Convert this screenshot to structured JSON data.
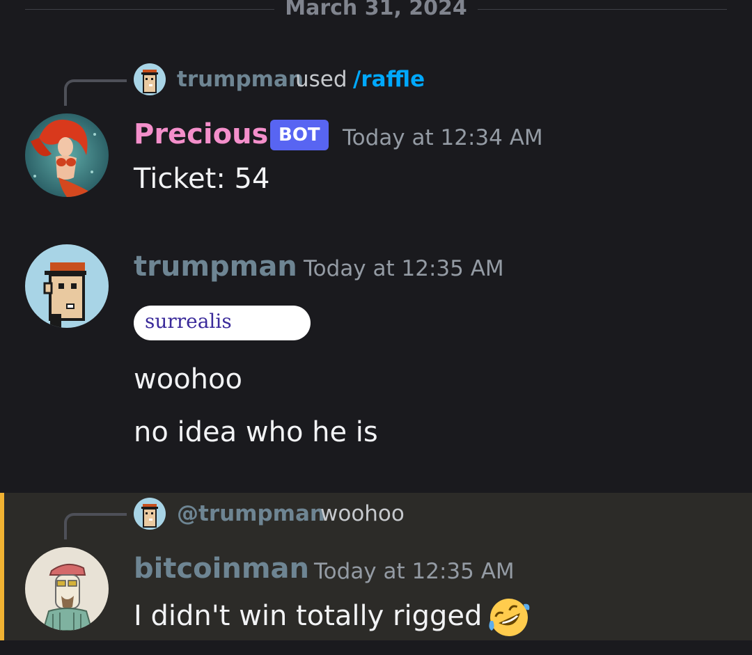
{
  "divider": {
    "date": "March 31, 2024"
  },
  "messages": [
    {
      "reply": {
        "user": "trumpman",
        "used": "used",
        "command": "/raffle"
      },
      "author": "Precious",
      "author_color": "#f48fcb",
      "bot_tag": "BOT",
      "timestamp": "Today at 12:34 AM",
      "text": "Ticket: 54",
      "avatar_icon": "mermaid-avatar"
    },
    {
      "author": "trumpman",
      "author_color": "#6e8593",
      "timestamp": "Today at 12:35 AM",
      "nickname_pill": "surrealis",
      "lines": [
        "woohoo",
        "no idea who he is"
      ],
      "avatar_icon": "pixel-punk-avatar"
    },
    {
      "reply": {
        "user": "@trumpman",
        "text": "woohoo"
      },
      "author": "bitcoinman",
      "author_color": "#6e8593",
      "timestamp": "Today at 12:35 AM",
      "text": "I didn't win totally rigged",
      "emoji": "rolling-on-floor-laughing",
      "avatar_icon": "sketch-avatar",
      "highlight_color": "#f0b232"
    }
  ]
}
